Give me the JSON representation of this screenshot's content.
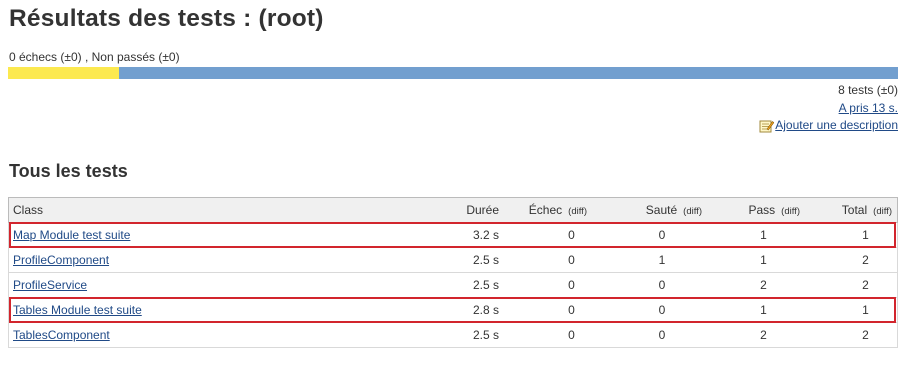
{
  "page": {
    "title": "Résultats des tests : (root)",
    "summary": "0 échecs (±0) , Non passés (±0)",
    "progress": {
      "failed_fraction": 0.0,
      "skipped_fraction": 0.125,
      "passed_fraction": 0.875
    },
    "colors": {
      "skip": "#fce94f",
      "pass": "#729fcf",
      "highlight": "#d2252d",
      "link": "#204a87"
    },
    "tests_count": "8 tests (±0)",
    "duration_link": "A pris 13 s.",
    "description_link": "Ajouter une description",
    "description_icon": "notepad-edit-icon"
  },
  "section": {
    "title": "Tous les tests"
  },
  "table": {
    "headers": {
      "class": "Class",
      "duration": "Durée",
      "fail": "Échec",
      "fail_diff": "(diff)",
      "skip": "Sauté",
      "skip_diff": "(diff)",
      "pass": "Pass",
      "pass_diff": "(diff)",
      "total": "Total",
      "total_diff": "(diff)"
    },
    "rows": [
      {
        "class": "Map Module test suite",
        "duration": "3.2 s",
        "fail": "0",
        "skip": "0",
        "pass": "1",
        "total": "1",
        "highlighted": true
      },
      {
        "class": "ProfileComponent",
        "duration": "2.5 s",
        "fail": "0",
        "skip": "1",
        "pass": "1",
        "total": "2",
        "highlighted": false
      },
      {
        "class": "ProfileService",
        "duration": "2.5 s",
        "fail": "0",
        "skip": "0",
        "pass": "2",
        "total": "2",
        "highlighted": false
      },
      {
        "class": "Tables Module test suite",
        "duration": "2.8 s",
        "fail": "0",
        "skip": "0",
        "pass": "1",
        "total": "1",
        "highlighted": true
      },
      {
        "class": "TablesComponent",
        "duration": "2.5 s",
        "fail": "0",
        "skip": "0",
        "pass": "2",
        "total": "2",
        "highlighted": false
      }
    ]
  }
}
